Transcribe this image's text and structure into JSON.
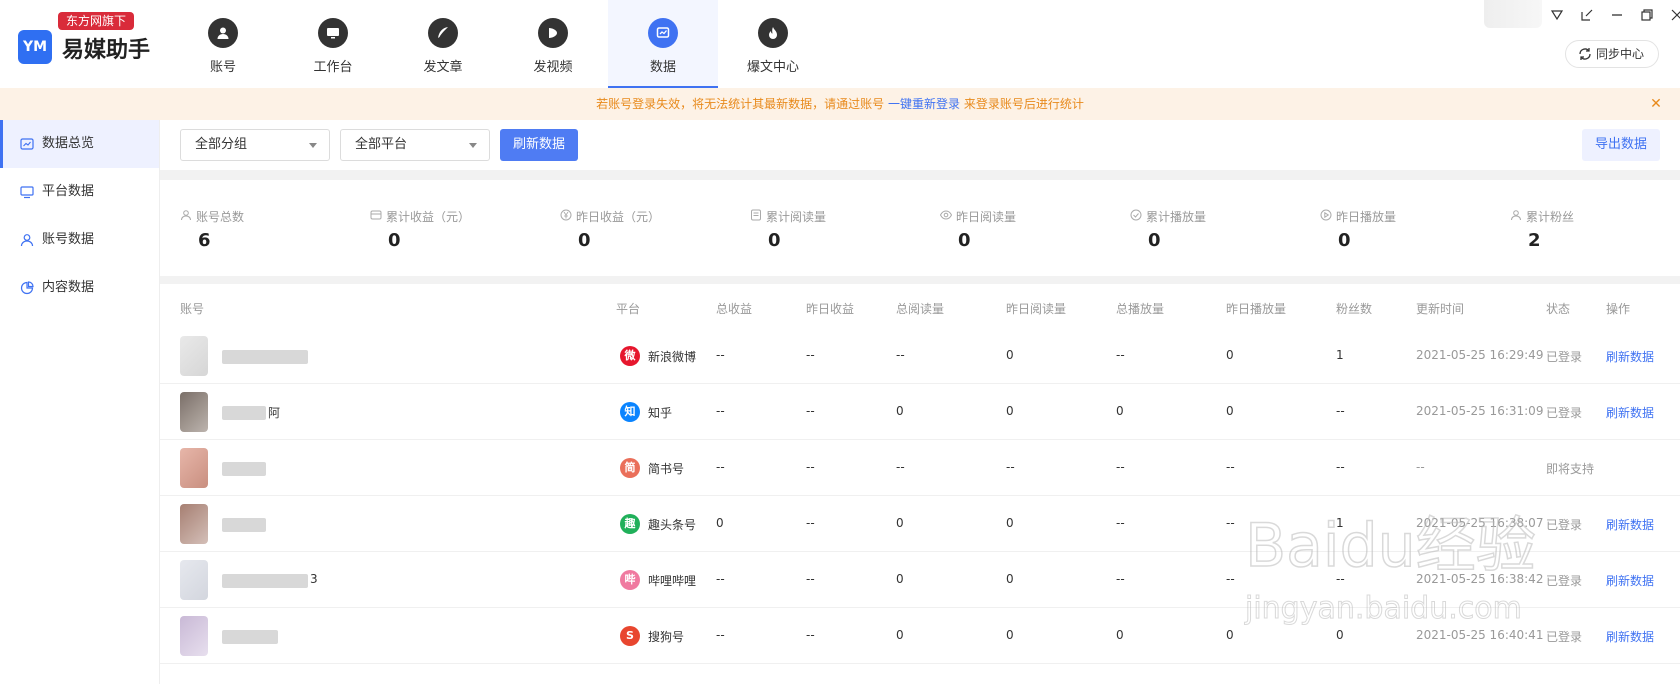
{
  "brand": {
    "badge": "东方网旗下",
    "name": "易媒助手",
    "mark": "YM"
  },
  "nav": [
    {
      "label": "账号",
      "icon": "user-icon",
      "active": false
    },
    {
      "label": "工作台",
      "icon": "monitor-icon",
      "active": false
    },
    {
      "label": "发文章",
      "icon": "feather-icon",
      "active": false
    },
    {
      "label": "发视频",
      "icon": "play-icon",
      "active": false
    },
    {
      "label": "数据",
      "icon": "chart-icon",
      "active": true
    },
    {
      "label": "爆文中心",
      "icon": "flame-icon",
      "active": false
    }
  ],
  "sync_label": "同步中心",
  "notice": {
    "part1": "若账号登录失效，将无法统计其最新数据，请通过账号",
    "link": "一键重新登录",
    "part2": "来登录账号后进行统计"
  },
  "sidebar": [
    {
      "label": "数据总览",
      "icon": "chart-box-icon",
      "active": true
    },
    {
      "label": "平台数据",
      "icon": "monitor-icon",
      "active": false
    },
    {
      "label": "账号数据",
      "icon": "user-icon",
      "active": false
    },
    {
      "label": "内容数据",
      "icon": "pie-icon",
      "active": false
    }
  ],
  "toolbar": {
    "group_select": "全部分组",
    "platform_select": "全部平台",
    "refresh_label": "刷新数据",
    "export_label": "导出数据"
  },
  "stats": [
    {
      "label": "账号总数",
      "value": "6",
      "icon": "user-icon"
    },
    {
      "label": "累计收益（元）",
      "value": "0",
      "icon": "wallet-icon"
    },
    {
      "label": "昨日收益（元）",
      "value": "0",
      "icon": "yen-icon"
    },
    {
      "label": "累计阅读量",
      "value": "0",
      "icon": "doc-icon"
    },
    {
      "label": "昨日阅读量",
      "value": "0",
      "icon": "eye-icon"
    },
    {
      "label": "累计播放量",
      "value": "0",
      "icon": "play-circle-icon"
    },
    {
      "label": "昨日播放量",
      "value": "0",
      "icon": "play-circle-icon"
    },
    {
      "label": "累计粉丝",
      "value": "2",
      "icon": "user-icon"
    }
  ],
  "table": {
    "headers": [
      "账号",
      "平台",
      "总收益",
      "昨日收益",
      "总阅读量",
      "昨日阅读量",
      "总播放量",
      "昨日播放量",
      "粉丝数",
      "更新时间",
      "状态",
      "操作"
    ],
    "rows": [
      {
        "name_suffix": "",
        "platform": "新浪微博",
        "platform_icon": "weibo-icon",
        "platform_color": "#e6162d",
        "platform_glyph": "微",
        "cells": [
          "--",
          "--",
          "--",
          "0",
          "--",
          "0",
          "1"
        ],
        "time": "2021-05-25 16:29:49",
        "status": "已登录",
        "action": "刷新数据"
      },
      {
        "name_suffix": "阿",
        "platform": "知乎",
        "platform_icon": "zhihu-icon",
        "platform_color": "#0a84ff",
        "platform_glyph": "知",
        "cells": [
          "--",
          "--",
          "0",
          "0",
          "0",
          "0",
          "--"
        ],
        "time": "2021-05-25 16:31:09",
        "status": "已登录",
        "action": "刷新数据"
      },
      {
        "name_suffix": "",
        "platform": "简书号",
        "platform_icon": "jianshu-icon",
        "platform_color": "#ea6f5a",
        "platform_glyph": "简",
        "cells": [
          "--",
          "--",
          "--",
          "--",
          "--",
          "--",
          "--"
        ],
        "time": "--",
        "status": "即将支持",
        "action": ""
      },
      {
        "name_suffix": "",
        "platform": "趣头条号",
        "platform_icon": "qutoutiao-icon",
        "platform_color": "#20b05a",
        "platform_glyph": "趣",
        "cells": [
          "0",
          "--",
          "0",
          "0",
          "--",
          "--",
          "1"
        ],
        "time": "2021-05-25 16:38:07",
        "status": "已登录",
        "action": "刷新数据"
      },
      {
        "name_suffix": "3",
        "platform": "哔哩哔哩",
        "platform_icon": "bilibili-icon",
        "platform_color": "#f07aa0",
        "platform_glyph": "哔",
        "cells": [
          "--",
          "--",
          "0",
          "0",
          "--",
          "--",
          "--"
        ],
        "time": "2021-05-25 16:38:42",
        "status": "已登录",
        "action": "刷新数据"
      },
      {
        "name_suffix": "",
        "platform": "搜狗号",
        "platform_icon": "sogou-icon",
        "platform_color": "#e8462f",
        "platform_glyph": "S",
        "cells": [
          "--",
          "--",
          "0",
          "0",
          "0",
          "0",
          "0"
        ],
        "time": "2021-05-25 16:40:41",
        "status": "已登录",
        "action": "刷新数据"
      }
    ]
  },
  "watermark": {
    "brand": "Baidu经验",
    "url": "jingyan.baidu.com"
  },
  "colors": {
    "accent": "#3f72f2",
    "notice_text": "#e88a1c",
    "notice_bg": "#fdf2e6"
  }
}
